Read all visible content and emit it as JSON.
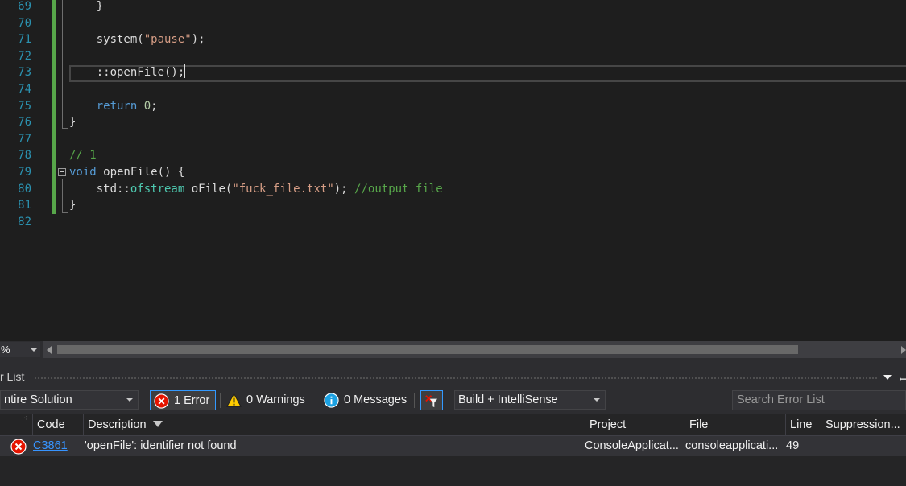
{
  "editor": {
    "lines": [
      {
        "num": "69",
        "tokens": [
          [
            "p",
            "    }"
          ]
        ]
      },
      {
        "num": "70",
        "tokens": []
      },
      {
        "num": "71",
        "tokens": [
          [
            "p",
            "    system("
          ],
          [
            "str",
            "\"pause\""
          ],
          [
            "p",
            ");"
          ]
        ]
      },
      {
        "num": "72",
        "tokens": []
      },
      {
        "num": "73",
        "tokens": [
          [
            "p",
            "    ::openFile();"
          ]
        ]
      },
      {
        "num": "74",
        "tokens": []
      },
      {
        "num": "75",
        "tokens": [
          [
            "p",
            "    "
          ],
          [
            "kw",
            "return"
          ],
          [
            "p",
            " "
          ],
          [
            "num",
            "0"
          ],
          [
            "p",
            ";"
          ]
        ]
      },
      {
        "num": "76",
        "tokens": [
          [
            "p",
            "}"
          ]
        ]
      },
      {
        "num": "77",
        "tokens": []
      },
      {
        "num": "78",
        "tokens": [
          [
            "cm",
            "// 1"
          ]
        ]
      },
      {
        "num": "79",
        "tokens": [
          [
            "kw",
            "void"
          ],
          [
            "p",
            " openFile() {"
          ]
        ]
      },
      {
        "num": "80",
        "tokens": [
          [
            "p",
            "    std::"
          ],
          [
            "ty",
            "ofstream"
          ],
          [
            "p",
            " oFile("
          ],
          [
            "str",
            "\"fuck_file.txt\""
          ],
          [
            "p",
            "); "
          ],
          [
            "cm",
            "//output file"
          ]
        ]
      },
      {
        "num": "81",
        "tokens": [
          [
            "p",
            "}"
          ]
        ]
      },
      {
        "num": "82",
        "tokens": []
      }
    ],
    "zoom": "%"
  },
  "error_list": {
    "title": "r List",
    "scope": "ntire Solution",
    "errors_label": "1 Error",
    "warnings_label": "0 Warnings",
    "messages_label": "0 Messages",
    "build_filter": "Build + IntelliSense",
    "search_placeholder": "Search Error List",
    "columns": {
      "code": "Code",
      "description": "Description",
      "project": "Project",
      "file": "File",
      "line": "Line",
      "suppression": "Suppression..."
    },
    "rows": [
      {
        "code": "C3861",
        "description": "'openFile': identifier not found",
        "project": "ConsoleApplicat...",
        "file": "consoleapplicati...",
        "line": "49"
      }
    ]
  },
  "colors": {
    "background": "#1e1e1e",
    "line_number": "#2b91af",
    "keyword": "#569cd6",
    "string": "#d69d85",
    "comment": "#57a64a",
    "error": "#e51400",
    "warning": "#ffcc00",
    "info": "#1ba1e2"
  }
}
